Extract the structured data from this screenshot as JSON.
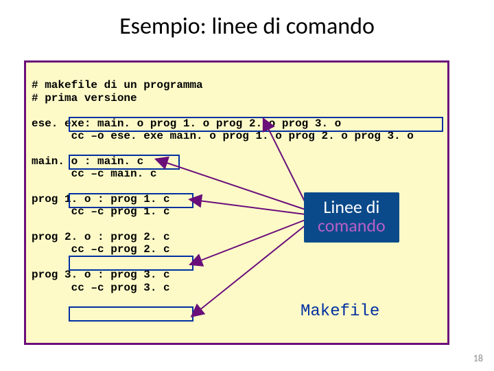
{
  "title": "Esempio: linee di comando",
  "makefile": {
    "comment1": "# makefile di un programma",
    "comment2": "# prima versione",
    "rule_ese": {
      "target_line": "ese. exe: main. o prog 1. o prog 2. o prog 3. o",
      "cmd": "cc –o ese. exe main. o prog 1. o prog 2. o prog 3. o"
    },
    "rule_main": {
      "target_line": "main. o : main. c",
      "cmd": "cc –c main. c"
    },
    "rule_p1": {
      "target_line": "prog 1. o : prog 1. c",
      "cmd": "cc –c prog 1. c"
    },
    "rule_p2": {
      "target_line": "prog 2. o : prog 2. c",
      "cmd": "cc –c prog 2. c"
    },
    "rule_p3": {
      "target_line": "prog 3. o : prog 3. c",
      "cmd": "cc –c prog 3. c"
    }
  },
  "callout": {
    "line1": "Linee di",
    "line2": "comando"
  },
  "label_makefile": "Makefile",
  "page_number": "18",
  "colors": {
    "code_bg": "#fdfac8",
    "code_border": "#6a0e7a",
    "highlight_border": "#0030a0",
    "callout_bg": "#0b4a8a",
    "callout_l2": "#b95fc8"
  }
}
